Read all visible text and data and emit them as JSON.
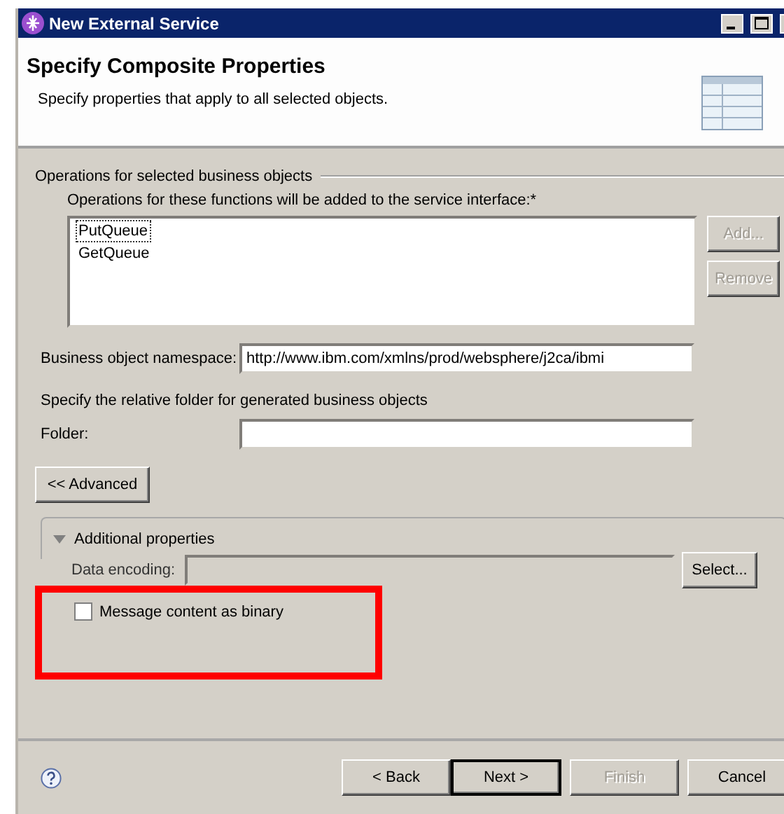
{
  "window": {
    "title": "New External Service"
  },
  "header": {
    "title": "Specify Composite Properties",
    "description": "Specify properties that apply to all selected objects."
  },
  "operations_group": {
    "title": "Operations for selected business objects",
    "list_label": "Operations for these functions will be added to the service interface:*",
    "operations": [
      {
        "name": "PutQueue",
        "focused": true
      },
      {
        "name": "GetQueue",
        "focused": false
      }
    ],
    "buttons": [
      {
        "label": "Add...",
        "disabled": true
      },
      {
        "label": "Remove",
        "disabled": true
      }
    ]
  },
  "namespace": {
    "label": "Business object namespace:",
    "value": "http://www.ibm.com/xmlns/prod/websphere/j2ca/ibmi"
  },
  "folder_hint": "Specify the relative folder for generated business objects",
  "folder": {
    "label": "Folder:"
  },
  "advanced_button": "<< Advanced",
  "additional_properties": {
    "title": "Additional properties",
    "expanded": true,
    "data_encoding": {
      "label": "Data encoding:",
      "disabled": true,
      "button": "Select..."
    },
    "binary_checkbox": {
      "label": "Message content as binary",
      "checked": false
    }
  },
  "footer_buttons": [
    {
      "label": "< Back",
      "default": false,
      "disabled": false
    },
    {
      "label": "Next >",
      "default": true,
      "disabled": false
    },
    {
      "label": "Finish",
      "default": false,
      "disabled": true
    },
    {
      "label": "Cancel",
      "default": false,
      "disabled": false
    }
  ]
}
